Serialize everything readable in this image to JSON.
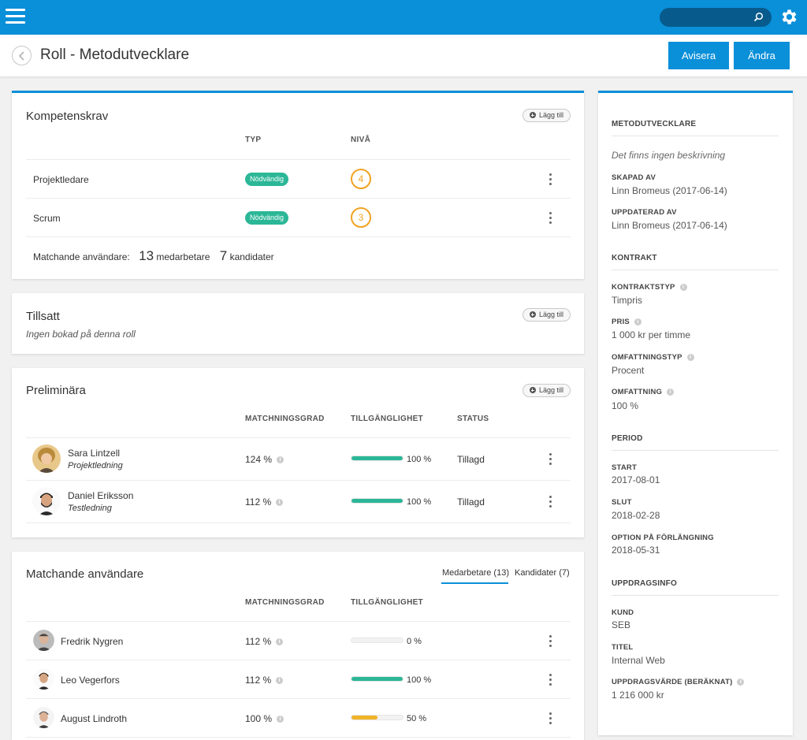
{
  "topbar": {
    "search_placeholder": ""
  },
  "header": {
    "title": "Roll - Metodutvecklare",
    "avisera_label": "Avisera",
    "andra_label": "Ändra"
  },
  "kompetenskrav": {
    "title": "Kompetenskrav",
    "add_label": "Lägg till",
    "col_typ": "TYP",
    "col_niva": "NIVÅ",
    "rows": [
      {
        "name": "Projektledare",
        "type": "Nödvändig",
        "level": "4"
      },
      {
        "name": "Scrum",
        "type": "Nödvändig",
        "level": "3"
      }
    ],
    "match_label": "Matchande användare:",
    "employees_count": "13",
    "employees_label": "medarbetare",
    "candidates_count": "7",
    "candidates_label": "kandidater"
  },
  "tillsatt": {
    "title": "Tillsatt",
    "add_label": "Lägg till",
    "empty_text": "Ingen bokad på denna roll"
  },
  "preliminara": {
    "title": "Preliminära",
    "add_label": "Lägg till",
    "col_match": "MATCHNINGSGRAD",
    "col_avail": "TILLGÄNGLIGHET",
    "col_status": "STATUS",
    "rows": [
      {
        "name": "Sara Lintzell",
        "role": "Projektledning",
        "match": "124 %",
        "availability": 100,
        "availability_label": "100 %",
        "status": "Tillagd"
      },
      {
        "name": "Daniel Eriksson",
        "role": "Testledning",
        "match": "112 %",
        "availability": 100,
        "availability_label": "100 %",
        "status": "Tillagd"
      }
    ]
  },
  "matchande": {
    "title": "Matchande användare",
    "tab_employees": "Medarbetare (13)",
    "tab_candidates": "Kandidater (7)",
    "col_match": "MATCHNINGSGRAD",
    "col_avail": "TILLGÄNGLIGHET",
    "rows": [
      {
        "name": "Fredrik Nygren",
        "match": "112 %",
        "availability": 0,
        "availability_label": "0 %"
      },
      {
        "name": "Leo Vegerfors",
        "match": "112 %",
        "availability": 100,
        "availability_label": "100 %"
      },
      {
        "name": "August Lindroth",
        "match": "100 %",
        "availability": 50,
        "availability_label": "50 %"
      }
    ]
  },
  "sidebar": {
    "role_heading": "METODUTVECKLARE",
    "description": "Det finns ingen beskrivning",
    "created_label": "SKAPAD AV",
    "created_value": "Linn Bromeus (2017-06-14)",
    "updated_label": "UPPDATERAD AV",
    "updated_value": "Linn Bromeus (2017-06-14)",
    "contract_heading": "KONTRAKT",
    "contract_type_label": "KONTRAKTSTYP",
    "contract_type_value": "Timpris",
    "price_label": "PRIS",
    "price_value": "1 000 kr per timme",
    "scope_type_label": "OMFATTNINGSTYP",
    "scope_type_value": "Procent",
    "scope_label": "OMFATTNING",
    "scope_value": "100 %",
    "period_heading": "PERIOD",
    "start_label": "START",
    "start_value": "2017-08-01",
    "end_label": "SLUT",
    "end_value": "2018-02-28",
    "option_label": "OPTION PÅ FÖRLÄNGNING",
    "option_value": "2018-05-31",
    "assignment_heading": "UPPDRAGSINFO",
    "customer_label": "KUND",
    "customer_value": "SEB",
    "title_label": "TITEL",
    "title_value": "Internal Web",
    "value_label": "UPPDRAGSVÄRDE (BERÄKNAT)",
    "value_value": "1 216 000 kr"
  },
  "colors": {
    "accent": "#0a8fd9",
    "badge": "#2bb797",
    "level": "#f0a323",
    "bar_full": "#2bb797",
    "bar_half": "#f0b429"
  }
}
